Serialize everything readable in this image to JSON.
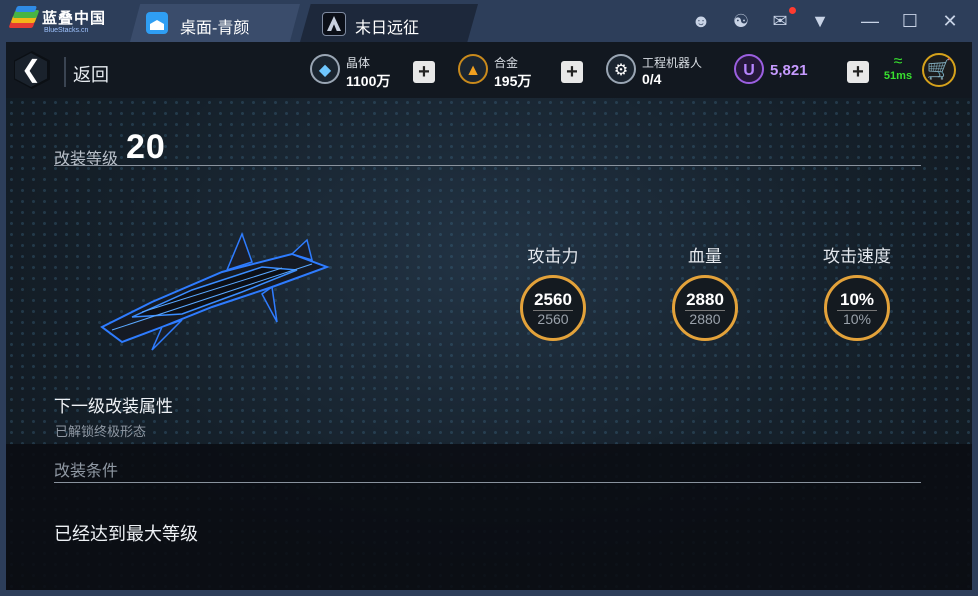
{
  "emulator": {
    "app_name": "蓝叠中国",
    "app_subname": "BlueStacks.cn",
    "tabs": [
      {
        "label": "桌面-青颜",
        "icon": "home-icon"
      },
      {
        "label": "末日远征",
        "icon": "game-icon",
        "active": true
      }
    ],
    "controls": [
      "account-icon",
      "shirt-icon",
      "mail-icon",
      "dropdown-icon",
      "minimize-icon",
      "maximize-icon",
      "close-icon"
    ]
  },
  "game": {
    "back_label": "返回",
    "resources": {
      "crystal": {
        "name": "晶体",
        "value": "1100万"
      },
      "alloy": {
        "name": "合金",
        "value": "195万"
      },
      "robot": {
        "name": "工程机器人",
        "value": "0/4"
      },
      "u_currency": {
        "symbol": "U",
        "value": "5,821"
      }
    },
    "ping": "51ms",
    "level": {
      "label": "改装等级",
      "value": "20"
    },
    "stats": [
      {
        "label": "攻击力",
        "current": "2560",
        "next": "2560"
      },
      {
        "label": "血量",
        "current": "2880",
        "next": "2880"
      },
      {
        "label": "攻击速度",
        "current": "10%",
        "next": "10%"
      }
    ],
    "next_level": {
      "title": "下一级改装属性",
      "desc": "已解锁终极形态"
    },
    "condition": {
      "title": "改装条件",
      "message": "已经达到最大等级"
    }
  },
  "colors": {
    "accent_ring": "#e3a23a",
    "ping_green": "#38e02f",
    "u_purple": "#9b5fe0",
    "titlebar": "#2d3e5a"
  }
}
